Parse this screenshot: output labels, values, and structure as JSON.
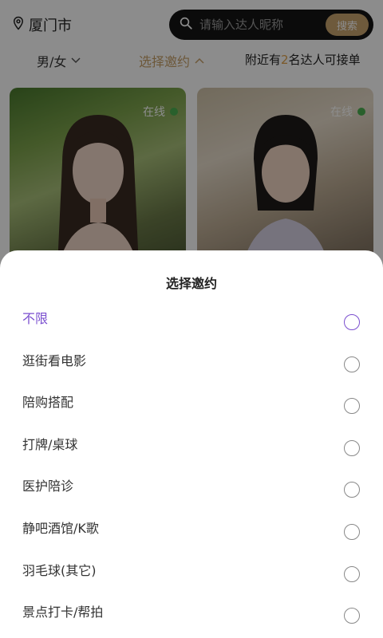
{
  "header": {
    "city": "厦门市",
    "search_placeholder": "请输入达人昵称",
    "search_button": "搜索"
  },
  "filters": {
    "gender": "男/女",
    "invite": "选择邀约",
    "nearby_prefix": "附近有",
    "nearby_count": "2",
    "nearby_suffix": "名达人可接单"
  },
  "cards": [
    {
      "status": "在线"
    },
    {
      "status": "在线"
    }
  ],
  "sheet": {
    "title": "选择邀约",
    "selected_index": 0,
    "options": [
      "不限",
      "逛街看电影",
      "陪购搭配",
      "打牌/桌球",
      "医护陪诊",
      "静吧酒馆/K歌",
      "羽毛球(其它)",
      "景点打卡/帮拍"
    ]
  },
  "colors": {
    "accent_gold": "#c7a069",
    "selected_purple": "#7b4fcf",
    "online_green": "#4caf50",
    "search_bg": "#151515"
  },
  "icons": {
    "location": "location-pin-icon",
    "search": "search-icon",
    "gender_dropdown": "chevron-down-icon",
    "invite_dropdown": "chevron-up-icon"
  }
}
